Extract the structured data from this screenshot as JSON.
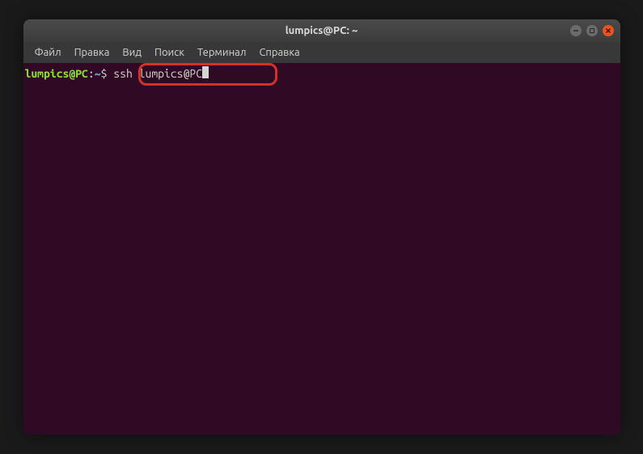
{
  "window": {
    "title": "lumpics@PC: ~"
  },
  "menu": {
    "items": [
      {
        "label": "Файл"
      },
      {
        "label": "Правка"
      },
      {
        "label": "Вид"
      },
      {
        "label": "Поиск"
      },
      {
        "label": "Терминал"
      },
      {
        "label": "Справка"
      }
    ]
  },
  "prompt": {
    "user_host": "lumpics@PC",
    "colon": ":",
    "path": "~",
    "symbol": "$"
  },
  "command": " ssh lumpics@PC"
}
